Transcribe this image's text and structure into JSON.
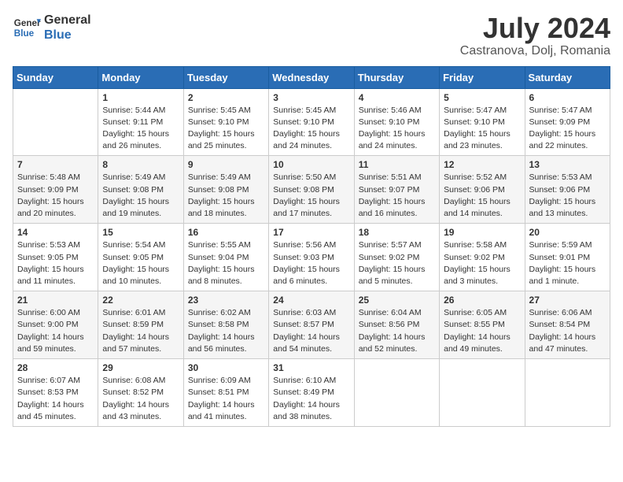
{
  "header": {
    "logo_line1": "General",
    "logo_line2": "Blue",
    "month": "July 2024",
    "location": "Castranova, Dolj, Romania"
  },
  "weekdays": [
    "Sunday",
    "Monday",
    "Tuesday",
    "Wednesday",
    "Thursday",
    "Friday",
    "Saturday"
  ],
  "weeks": [
    [
      {
        "day": "",
        "info": ""
      },
      {
        "day": "1",
        "info": "Sunrise: 5:44 AM\nSunset: 9:11 PM\nDaylight: 15 hours\nand 26 minutes."
      },
      {
        "day": "2",
        "info": "Sunrise: 5:45 AM\nSunset: 9:10 PM\nDaylight: 15 hours\nand 25 minutes."
      },
      {
        "day": "3",
        "info": "Sunrise: 5:45 AM\nSunset: 9:10 PM\nDaylight: 15 hours\nand 24 minutes."
      },
      {
        "day": "4",
        "info": "Sunrise: 5:46 AM\nSunset: 9:10 PM\nDaylight: 15 hours\nand 24 minutes."
      },
      {
        "day": "5",
        "info": "Sunrise: 5:47 AM\nSunset: 9:10 PM\nDaylight: 15 hours\nand 23 minutes."
      },
      {
        "day": "6",
        "info": "Sunrise: 5:47 AM\nSunset: 9:09 PM\nDaylight: 15 hours\nand 22 minutes."
      }
    ],
    [
      {
        "day": "7",
        "info": "Sunrise: 5:48 AM\nSunset: 9:09 PM\nDaylight: 15 hours\nand 20 minutes."
      },
      {
        "day": "8",
        "info": "Sunrise: 5:49 AM\nSunset: 9:08 PM\nDaylight: 15 hours\nand 19 minutes."
      },
      {
        "day": "9",
        "info": "Sunrise: 5:49 AM\nSunset: 9:08 PM\nDaylight: 15 hours\nand 18 minutes."
      },
      {
        "day": "10",
        "info": "Sunrise: 5:50 AM\nSunset: 9:08 PM\nDaylight: 15 hours\nand 17 minutes."
      },
      {
        "day": "11",
        "info": "Sunrise: 5:51 AM\nSunset: 9:07 PM\nDaylight: 15 hours\nand 16 minutes."
      },
      {
        "day": "12",
        "info": "Sunrise: 5:52 AM\nSunset: 9:06 PM\nDaylight: 15 hours\nand 14 minutes."
      },
      {
        "day": "13",
        "info": "Sunrise: 5:53 AM\nSunset: 9:06 PM\nDaylight: 15 hours\nand 13 minutes."
      }
    ],
    [
      {
        "day": "14",
        "info": "Sunrise: 5:53 AM\nSunset: 9:05 PM\nDaylight: 15 hours\nand 11 minutes."
      },
      {
        "day": "15",
        "info": "Sunrise: 5:54 AM\nSunset: 9:05 PM\nDaylight: 15 hours\nand 10 minutes."
      },
      {
        "day": "16",
        "info": "Sunrise: 5:55 AM\nSunset: 9:04 PM\nDaylight: 15 hours\nand 8 minutes."
      },
      {
        "day": "17",
        "info": "Sunrise: 5:56 AM\nSunset: 9:03 PM\nDaylight: 15 hours\nand 6 minutes."
      },
      {
        "day": "18",
        "info": "Sunrise: 5:57 AM\nSunset: 9:02 PM\nDaylight: 15 hours\nand 5 minutes."
      },
      {
        "day": "19",
        "info": "Sunrise: 5:58 AM\nSunset: 9:02 PM\nDaylight: 15 hours\nand 3 minutes."
      },
      {
        "day": "20",
        "info": "Sunrise: 5:59 AM\nSunset: 9:01 PM\nDaylight: 15 hours\nand 1 minute."
      }
    ],
    [
      {
        "day": "21",
        "info": "Sunrise: 6:00 AM\nSunset: 9:00 PM\nDaylight: 14 hours\nand 59 minutes."
      },
      {
        "day": "22",
        "info": "Sunrise: 6:01 AM\nSunset: 8:59 PM\nDaylight: 14 hours\nand 57 minutes."
      },
      {
        "day": "23",
        "info": "Sunrise: 6:02 AM\nSunset: 8:58 PM\nDaylight: 14 hours\nand 56 minutes."
      },
      {
        "day": "24",
        "info": "Sunrise: 6:03 AM\nSunset: 8:57 PM\nDaylight: 14 hours\nand 54 minutes."
      },
      {
        "day": "25",
        "info": "Sunrise: 6:04 AM\nSunset: 8:56 PM\nDaylight: 14 hours\nand 52 minutes."
      },
      {
        "day": "26",
        "info": "Sunrise: 6:05 AM\nSunset: 8:55 PM\nDaylight: 14 hours\nand 49 minutes."
      },
      {
        "day": "27",
        "info": "Sunrise: 6:06 AM\nSunset: 8:54 PM\nDaylight: 14 hours\nand 47 minutes."
      }
    ],
    [
      {
        "day": "28",
        "info": "Sunrise: 6:07 AM\nSunset: 8:53 PM\nDaylight: 14 hours\nand 45 minutes."
      },
      {
        "day": "29",
        "info": "Sunrise: 6:08 AM\nSunset: 8:52 PM\nDaylight: 14 hours\nand 43 minutes."
      },
      {
        "day": "30",
        "info": "Sunrise: 6:09 AM\nSunset: 8:51 PM\nDaylight: 14 hours\nand 41 minutes."
      },
      {
        "day": "31",
        "info": "Sunrise: 6:10 AM\nSunset: 8:49 PM\nDaylight: 14 hours\nand 38 minutes."
      },
      {
        "day": "",
        "info": ""
      },
      {
        "day": "",
        "info": ""
      },
      {
        "day": "",
        "info": ""
      }
    ]
  ]
}
